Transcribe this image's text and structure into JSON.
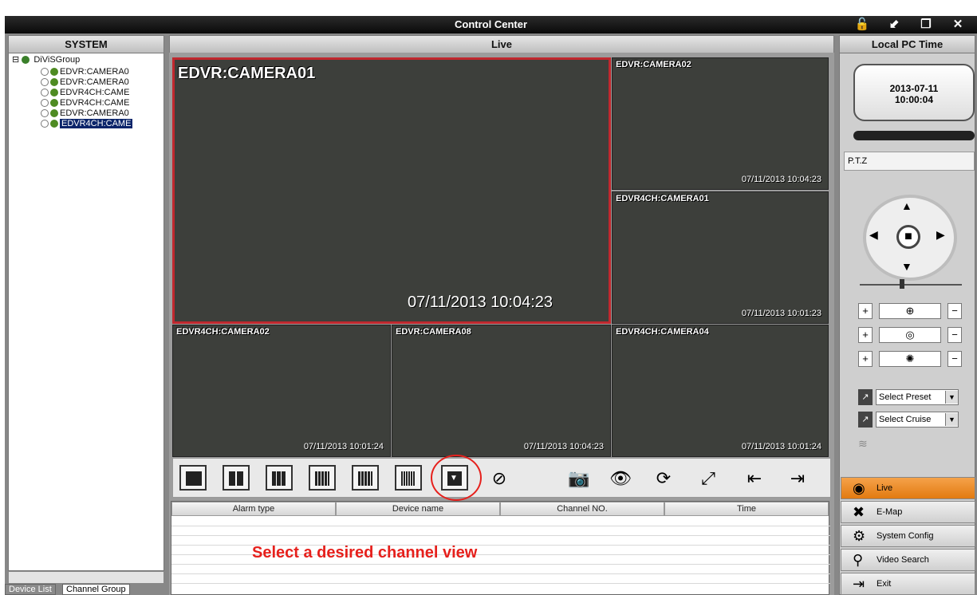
{
  "window": {
    "title": "Control Center"
  },
  "panels": {
    "system": "SYSTEM",
    "live": "Live",
    "pc_time": "Local PC Time"
  },
  "tree": {
    "root": "DiViSGroup",
    "items": [
      "EDVR:CAMERA0",
      "EDVR:CAMERA0",
      "EDVR4CH:CAME",
      "EDVR4CH:CAME",
      "EDVR:CAMERA0",
      "EDVR4CH:CAME"
    ]
  },
  "left_tabs": [
    "Device List",
    "Channel Group"
  ],
  "cameras": [
    {
      "name": "EDVR:CAMERA01",
      "overlay": "CAMERA01",
      "time": "07/11/2013 10:04:23"
    },
    {
      "name": "EDVR:CAMERA02",
      "overlay": "CAMERA02",
      "time": "07/11/2013 10:04:23"
    },
    {
      "name": "EDVR4CH:CAMERA01",
      "overlay": "CAMERA01",
      "time": "07/11/2013 10:01:23"
    },
    {
      "name": "EDVR4CH:CAMERA02",
      "overlay": "CAMERA02",
      "time": "07/11/2013 10:01:24"
    },
    {
      "name": "EDVR:CAMERA08",
      "overlay": "CAMERA08",
      "time": "07/11/2013 10:04:23"
    },
    {
      "name": "EDVR4CH:CAMERA04",
      "overlay": "CAMERA04",
      "time": "07/11/2013 10:01:24"
    }
  ],
  "alarm_headers": [
    "Alarm type",
    "Device name",
    "Channel NO.",
    "Time"
  ],
  "annotation": "Select a desired channel view",
  "clock": {
    "date": "2013-07-11",
    "time": "10:00:04"
  },
  "ptz": {
    "label": "P.T.Z",
    "select_preset": "Select Preset",
    "select_cruise": "Select Cruise"
  },
  "nav": [
    {
      "label": "Live",
      "icon": "eye-icon"
    },
    {
      "label": "E-Map",
      "icon": "map-icon"
    },
    {
      "label": "System Config",
      "icon": "gear-icon"
    },
    {
      "label": "Video Search",
      "icon": "search-icon"
    },
    {
      "label": "Exit",
      "icon": "exit-icon"
    }
  ],
  "colors": {
    "accent": "#e27a10",
    "selected_border": "#c0282e",
    "annotation": "#e6201c"
  }
}
